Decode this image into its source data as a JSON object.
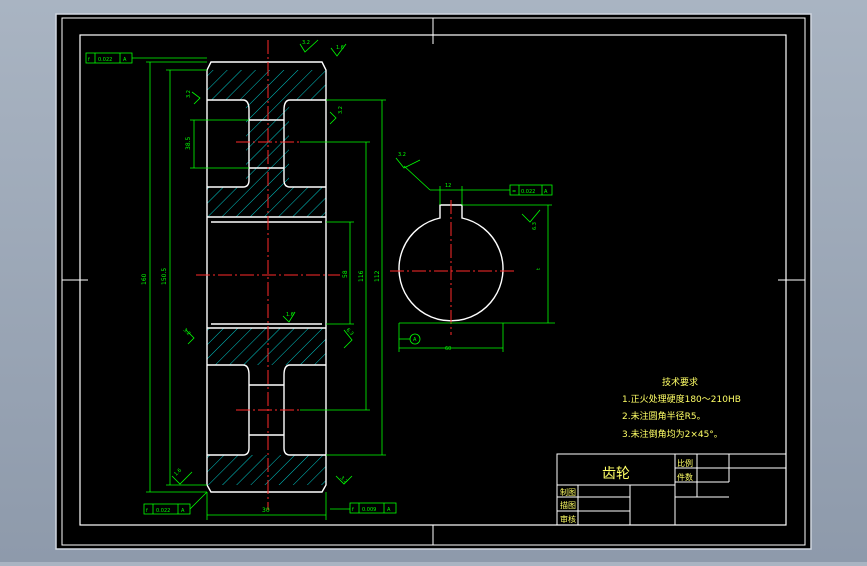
{
  "colors": {
    "background": "#000000",
    "frame": "#ffffff",
    "dimension": "#00ff00",
    "centerline": "#ff2a2a",
    "hatch": "#00c8c8",
    "outline": "#ffffff",
    "notes": "#ffff66"
  },
  "tolerance_frames": {
    "top_left": {
      "symbol": "f",
      "value": "0.022",
      "datum": "A"
    },
    "bottom_left": {
      "symbol": "f",
      "value": "0.022",
      "datum": "A"
    },
    "bottom_right": {
      "symbol": "f",
      "value": "0.009",
      "datum": "A"
    },
    "keyway": {
      "symbol": "=",
      "value": "0.022",
      "datum": "A"
    }
  },
  "roughness": {
    "r1": "3.2",
    "r2": "1.6",
    "r3": "3.2",
    "r4": "3.2",
    "r5": "1.6",
    "r6": "3.2",
    "r7": "6.3",
    "r8": "1.6",
    "r9": "3.2",
    "r10": "3.2",
    "r11": "6.3",
    "r12": "3.2"
  },
  "dimensions": {
    "d1": "160",
    "d2": "150.5",
    "d3": "38.5",
    "d4": "58",
    "d5": "116",
    "d6": "30",
    "d7": "12",
    "d8": "t",
    "d9": "Φ7",
    "d10": "60",
    "d11": "112"
  },
  "datum": {
    "label": "A"
  },
  "notes": {
    "title": "技术要求",
    "items": [
      "1.正火处理硬度180～210HB",
      "2.未注圆角半径R5。",
      "3.未注倒角均为2×45°。"
    ]
  },
  "title_block": {
    "part_name": "齿轮",
    "scale_label": "比例",
    "qty_label": "件数",
    "drawn_label": "制图",
    "check_label": "描图",
    "review_label": "审核"
  }
}
